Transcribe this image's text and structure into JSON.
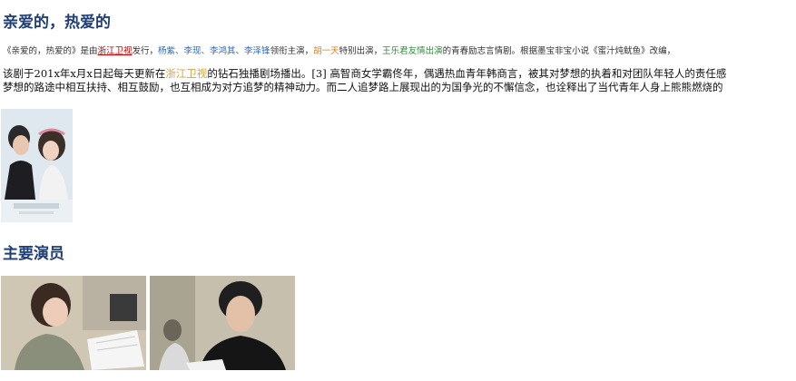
{
  "article": {
    "title": "亲爱的，热爱的",
    "intro": {
      "t1": "《亲爱的，热爱的》是由",
      "channel": "浙江卫视",
      "t2": "发行，",
      "leads": "杨紫、李现、李鸿其、李泽锋",
      "t3": "领衔主演，",
      "special": "胡一天",
      "t4": "特别出演，",
      "friendship": "王乐君友情出演",
      "t5": "的青春励志言情剧。根据墨宝非宝小说《蜜汁炖鱿鱼》改编，"
    },
    "para_line1": {
      "a": "该剧于201x年x月x日起每天更新在",
      "channel": "浙江卫视",
      "b": "的钻石独播剧场播出。[3] 高智商女学霸佟年，偶遇热血青年韩商言，被其对梦想的执着和对团队年轻人的责任感"
    },
    "para_line2": "梦想的路途中相互扶持、相互鼓励，也互相成为对方追梦的精神动力。而二人追梦路上展现出的为国争光的不懈信念，也诠释出了当代青年人身上熊熊燃烧的",
    "cast_heading": "主要演员"
  },
  "colors": {
    "heading": "#1f3f75",
    "link_red": "#c40000",
    "link_blue": "#2f66b3",
    "link_orange": "#e07b1a",
    "link_green": "#2e8b3a",
    "link_gold": "#d4a046"
  },
  "images": {
    "poster": "drama-poster-image",
    "cast_1": "actress-photo",
    "cast_2": "actor-photo"
  }
}
